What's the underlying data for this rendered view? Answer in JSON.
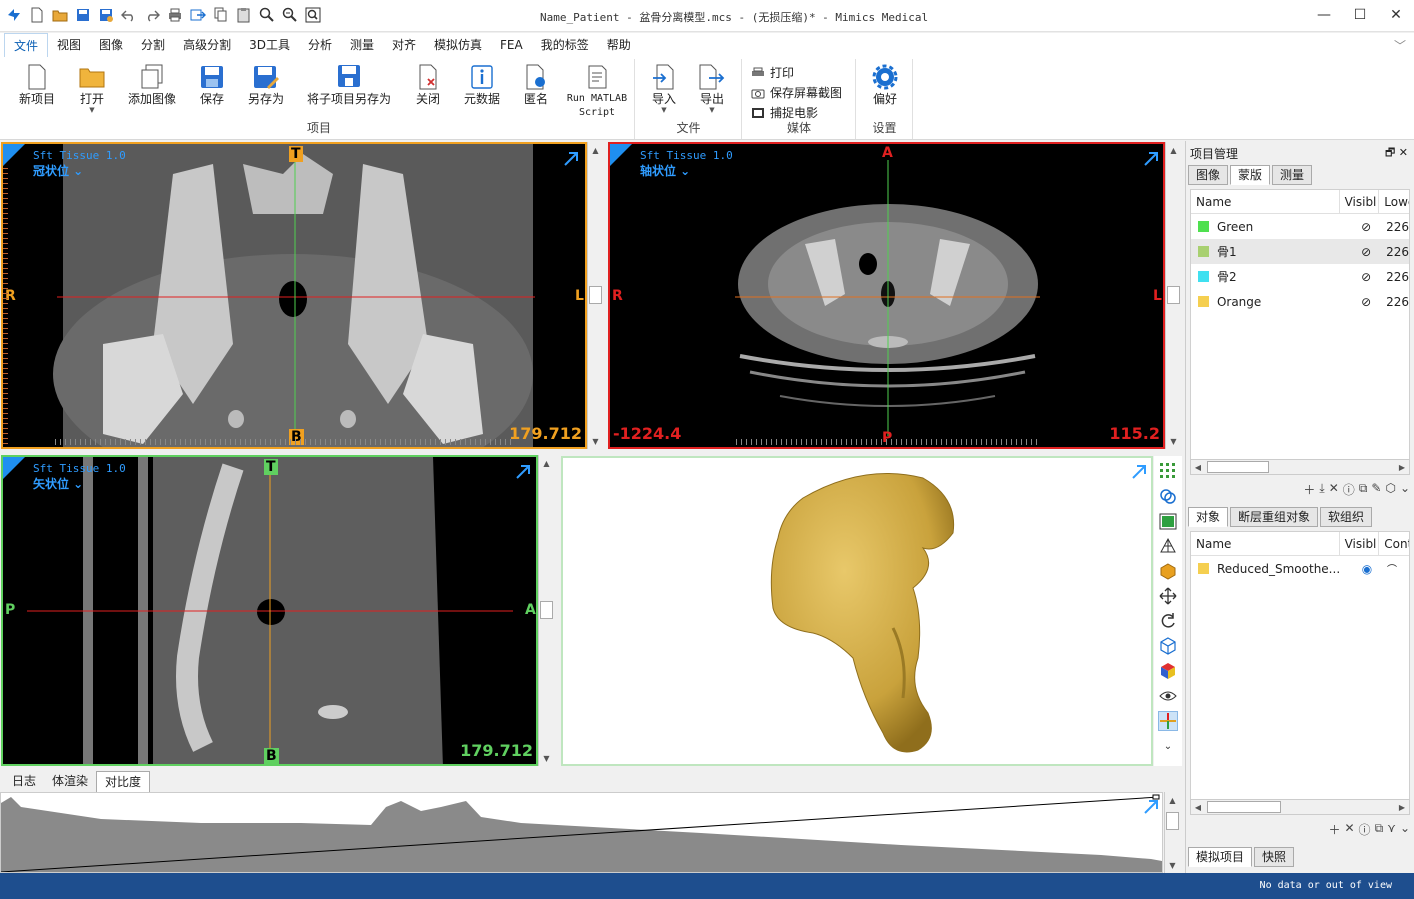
{
  "window": {
    "title": "Name_Patient - 盆骨分离模型.mcs - (无损压缩)* - Mimics Medical",
    "min": "—",
    "max": "☐",
    "close": "✕"
  },
  "menu": [
    "文件",
    "视图",
    "图像",
    "分割",
    "高级分割",
    "3D工具",
    "分析",
    "测量",
    "对齐",
    "模拟仿真",
    "FEA",
    "我的标签",
    "帮助"
  ],
  "ribbon": {
    "project": {
      "label": "项目",
      "buttons": [
        "新项目",
        "打开",
        "添加图像",
        "保存",
        "另存为",
        "将子项目另存为",
        "关闭",
        "元数据",
        "匿名"
      ],
      "run1": "Run MATLAB",
      "run2": "Script"
    },
    "file": {
      "label": "文件",
      "buttons": [
        "导入",
        "导出"
      ]
    },
    "media": {
      "label": "媒体",
      "items": [
        "打印",
        "保存屏幕截图",
        "捕捉电影"
      ]
    },
    "settings": {
      "label": "设置",
      "buttons": [
        "偏好"
      ]
    }
  },
  "viewports": {
    "coronal": {
      "title": "Sft Tissue 1.0",
      "sub": "冠状位 ⌄",
      "top": "T",
      "bottom": "B",
      "left": "R",
      "right": "L",
      "value": "179.712"
    },
    "axial": {
      "title": "Sft Tissue 1.0",
      "sub": "轴状位 ⌄",
      "top": "A",
      "bottom": "P",
      "left": "R",
      "right": "L",
      "value": "115.2",
      "value2": "-1224.4"
    },
    "sagittal": {
      "title": "Sft Tissue 1.0",
      "sub": "矢状位 ⌄",
      "top": "T",
      "bottom": "B",
      "left": "P",
      "right": "A",
      "value": "179.712"
    }
  },
  "project_panel": {
    "title": "项目管理",
    "tabs": [
      "图像",
      "蒙版",
      "测量"
    ],
    "columns": [
      "Name",
      "Visibl",
      "Lowe"
    ],
    "masks": [
      {
        "name": "Green",
        "color": "#4fe04f",
        "low": "226"
      },
      {
        "name": "骨1",
        "color": "#a8d070",
        "low": "226"
      },
      {
        "name": "骨2",
        "color": "#40e0f0",
        "low": "226"
      },
      {
        "name": "Orange",
        "color": "#f5cf50",
        "low": "226"
      }
    ],
    "obj_tabs": [
      "对象",
      "断层重组对象",
      "软组织"
    ],
    "obj_columns": [
      "Name",
      "Visibl",
      "Cont"
    ],
    "objects": [
      {
        "name": "Reduced_Smoothe...",
        "color": "#f5cf50"
      }
    ],
    "bottom_tabs": [
      "模拟项目",
      "快照"
    ]
  },
  "bottom_tabs": [
    "日志",
    "体渲染",
    "对比度"
  ],
  "status": "No data or out of view"
}
